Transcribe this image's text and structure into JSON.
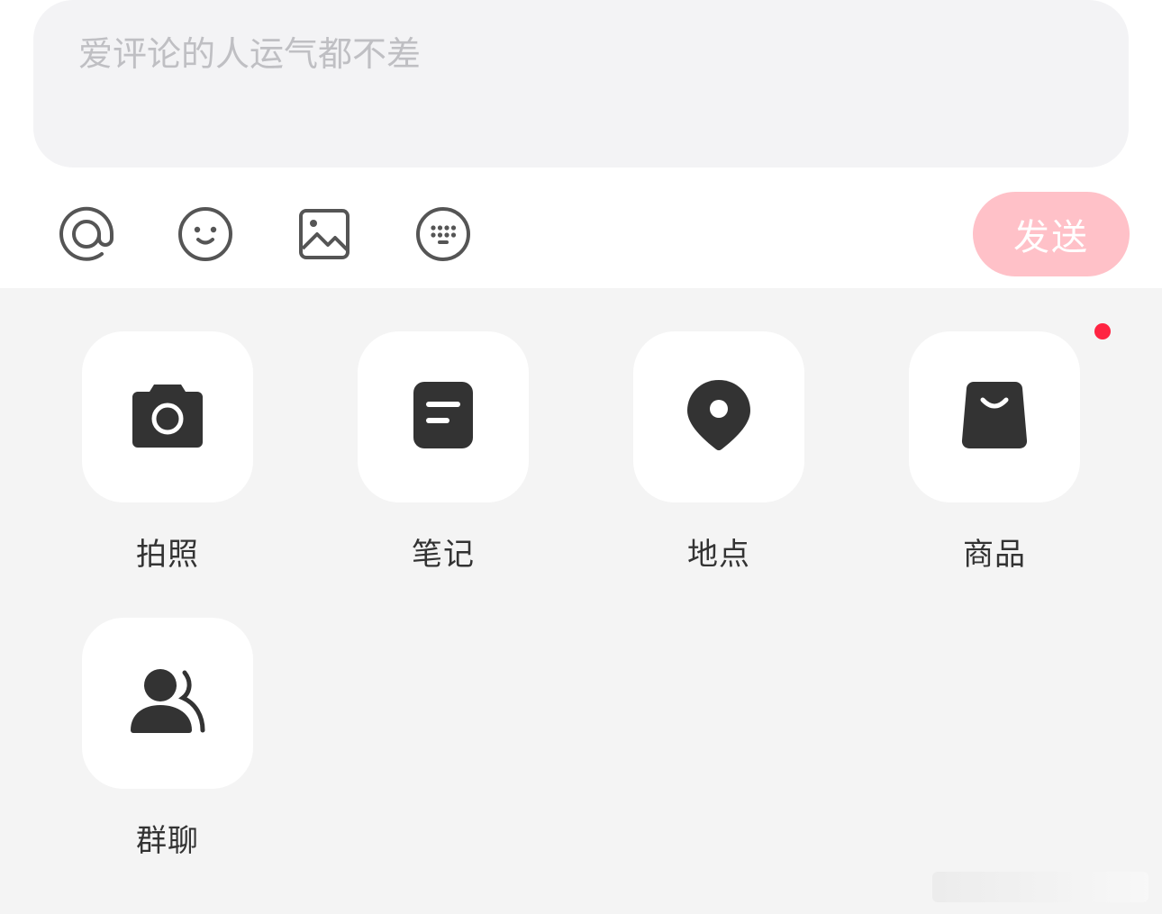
{
  "comment": {
    "placeholder": "爱评论的人运气都不差",
    "value": ""
  },
  "toolbar": {
    "tools": [
      {
        "icon": "at-icon"
      },
      {
        "icon": "emoji-icon"
      },
      {
        "icon": "image-icon"
      },
      {
        "icon": "keyboard-icon"
      }
    ],
    "send_label": "发送",
    "send_color": "#ffc1c8"
  },
  "panel": {
    "items": [
      {
        "label": "拍照",
        "icon": "camera-icon"
      },
      {
        "label": "笔记",
        "icon": "note-icon"
      },
      {
        "label": "地点",
        "icon": "location-pin-icon"
      },
      {
        "label": "商品",
        "icon": "shopping-bag-icon",
        "badge": true
      },
      {
        "label": "群聊",
        "icon": "group-chat-icon"
      }
    ],
    "badge_color": "#ff2442"
  }
}
